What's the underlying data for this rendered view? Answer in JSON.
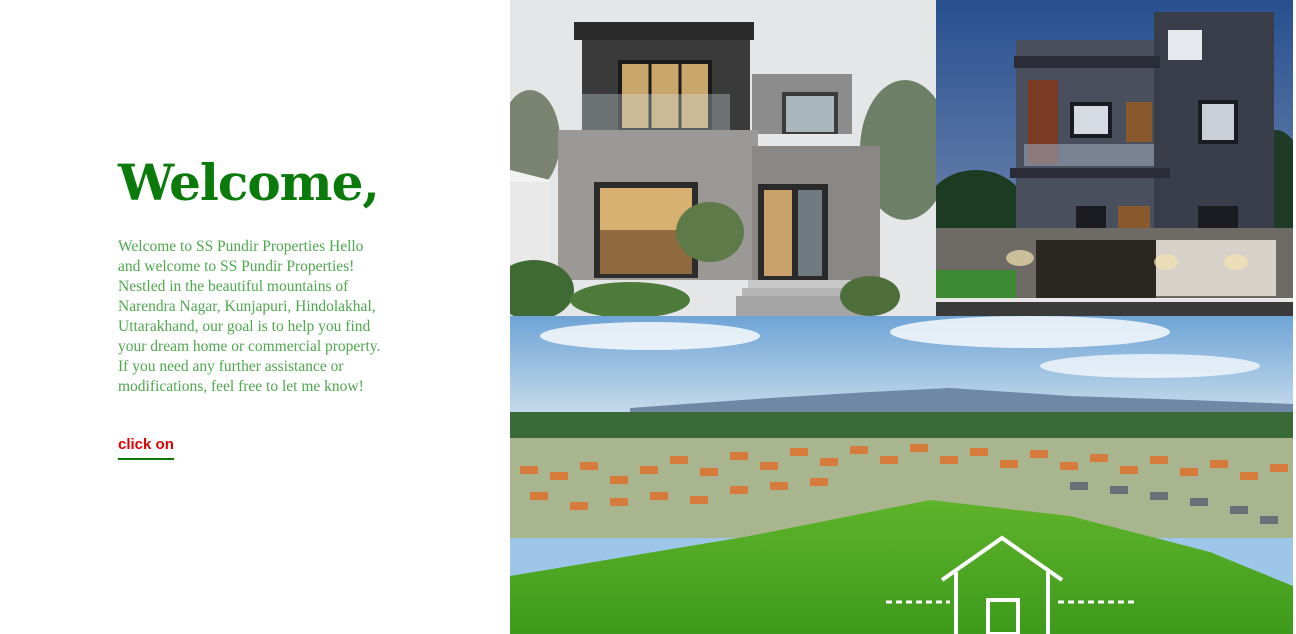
{
  "hero": {
    "title": "Welcome,",
    "description": "Welcome to SS Pundir Properties Hello and welcome to SS Pundir Properties! Nestled in the beautiful mountains of Narendra Nagar, Kunjapuri, Hindolakhal, Uttarakhand, our goal is to help you find your dream home or commercial property. If you need any further assistance or modifications, feel free to let me know!",
    "link_label": "click on"
  },
  "gallery": {
    "images": [
      "modern-house-photo",
      "villa-night-photo",
      "township-field-photo"
    ]
  },
  "colors": {
    "title": "#0a7a0a",
    "text": "#4ea84e",
    "link": "#e00000",
    "link_underline": "#0a7a0a"
  }
}
